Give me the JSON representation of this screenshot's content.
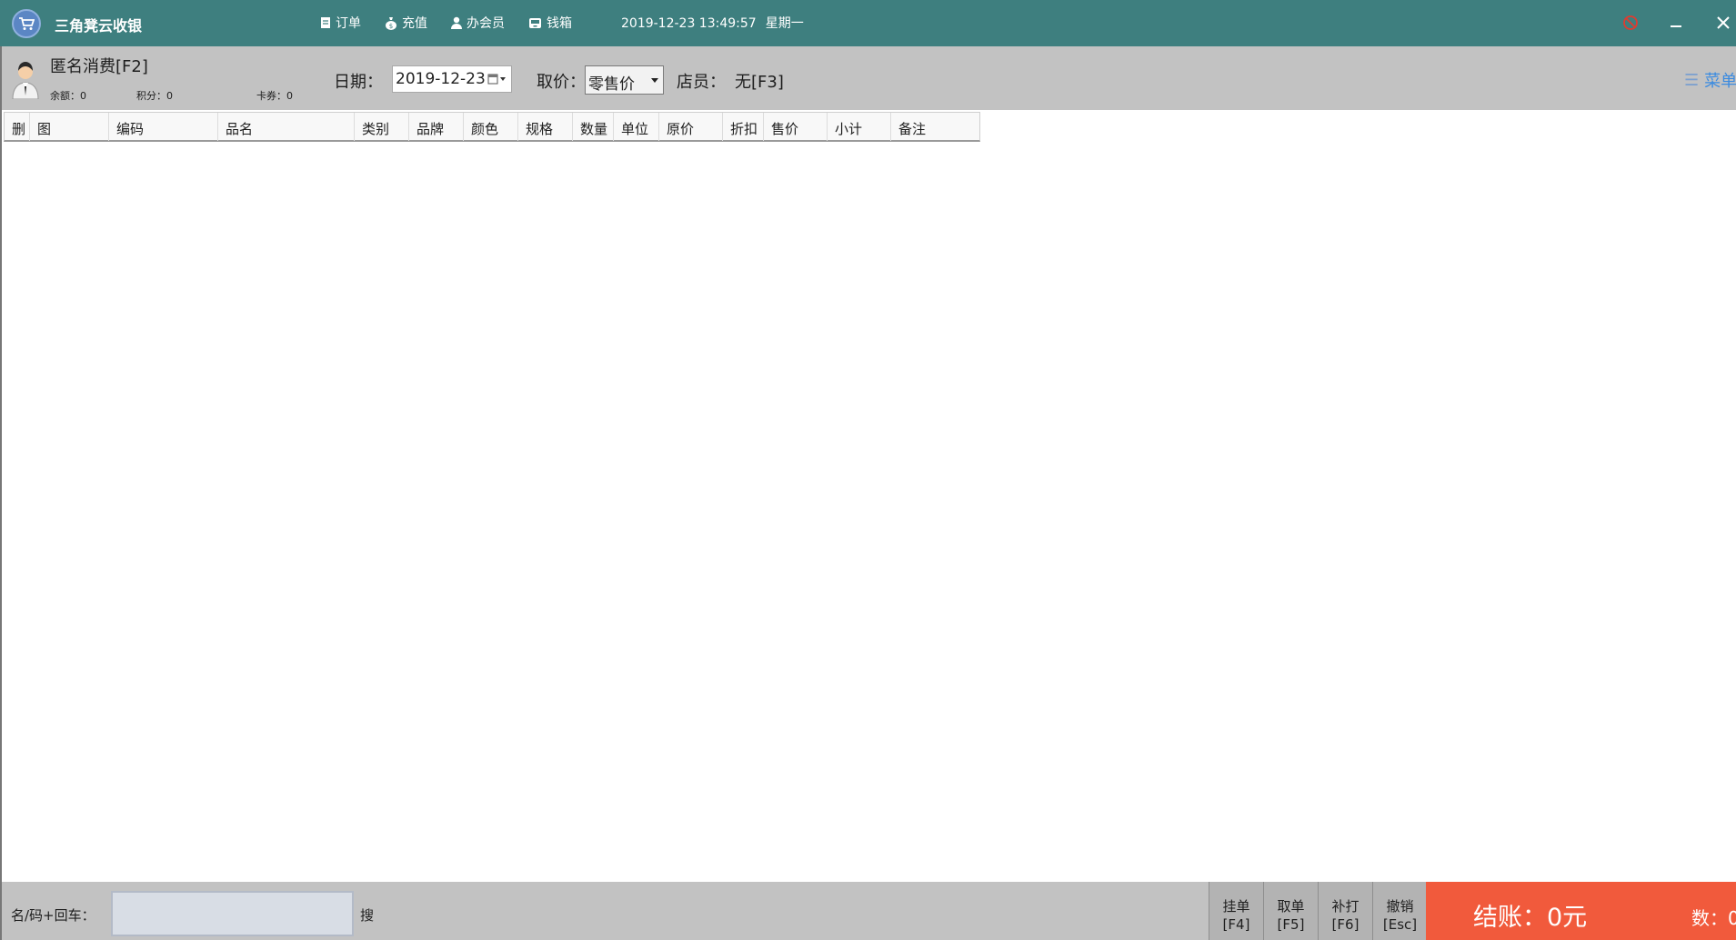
{
  "app": {
    "title": "三角凳云收银"
  },
  "topnav": [
    {
      "label": "订单",
      "icon": "document-icon"
    },
    {
      "label": "充值",
      "icon": "money-bag-icon"
    },
    {
      "label": "办会员",
      "icon": "user-icon"
    },
    {
      "label": "钱箱",
      "icon": "cash-drawer-icon"
    }
  ],
  "datetime": {
    "time": "2019-12-23 13:49:57",
    "weekday": "星期一"
  },
  "member": {
    "name": "匿名消费[F2]",
    "balance": "余额：0",
    "points": "积分：0",
    "coupons": "卡券：0"
  },
  "toolbar": {
    "date_label": "日期：",
    "date_value": "2019-12-23",
    "price_label": "取价：",
    "price_value": "零售价",
    "clerk_label": "店员：",
    "clerk_value": "无[F3]",
    "menu_label": "菜单"
  },
  "table": {
    "columns": [
      "删",
      "图",
      "编码",
      "品名",
      "类别",
      "品牌",
      "颜色",
      "规格",
      "数量",
      "单位",
      "原价",
      "折扣",
      "售价",
      "小计",
      "备注"
    ],
    "rows": []
  },
  "bottom": {
    "search_label": "名/码+回车：",
    "search_value": "",
    "search_button": "搜",
    "hold": [
      "挂单",
      "[F4]"
    ],
    "retrieve": [
      "取单",
      "[F5]"
    ],
    "reprint": [
      "补打",
      "[F6]"
    ],
    "cancel": [
      "撤销",
      "[Esc]"
    ],
    "checkout_label": "结账：0元",
    "count_label": "数：0"
  },
  "colors": {
    "titlebar": "#3e7f7f",
    "toolbar": "#c2c2c2",
    "checkout": "#f15a3c",
    "menu_link": "#3b8be0"
  }
}
